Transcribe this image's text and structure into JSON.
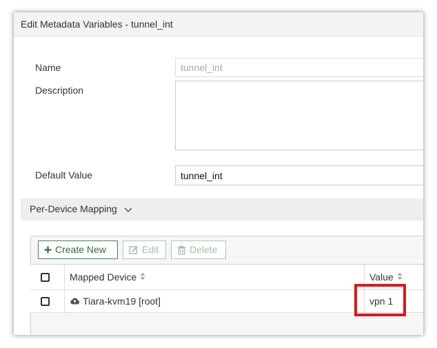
{
  "dialog": {
    "title": "Edit Metadata Variables - tunnel_int"
  },
  "form": {
    "name_label": "Name",
    "name_value": "tunnel_int",
    "description_label": "Description",
    "description_value": "",
    "default_value_label": "Default Value",
    "default_value": "tunnel_int"
  },
  "mapping": {
    "section_title": "Per-Device Mapping",
    "toolbar": {
      "create_label": "Create New",
      "edit_label": "Edit",
      "delete_label": "Delete"
    },
    "columns": {
      "device": "Mapped Device",
      "value": "Value"
    },
    "rows": [
      {
        "device": "Tiara-kvm19 [root]",
        "value": "vpn 1"
      }
    ]
  },
  "colors": {
    "accent_green": "#3c8a4b",
    "highlight_red": "#e0161b"
  }
}
